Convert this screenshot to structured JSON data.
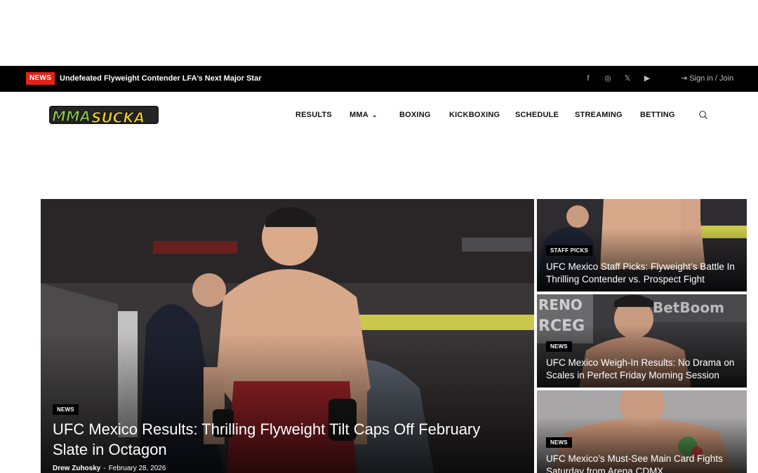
{
  "topbar": {
    "badge": "NEWS",
    "ticker": "Undefeated Flyweight Contender LFA’s Next Major Star",
    "social": [
      {
        "icon": "facebook-icon",
        "glyph": "f"
      },
      {
        "icon": "instagram-icon",
        "glyph": "◎"
      },
      {
        "icon": "x-twitter-icon",
        "glyph": "𝕏"
      },
      {
        "icon": "youtube-icon",
        "glyph": "▶"
      }
    ],
    "signin": "Sign in / Join"
  },
  "logo": {
    "text_left": "MMA",
    "text_right": "SUCKA"
  },
  "nav": {
    "items": [
      "RESULTS",
      "MMA",
      "BOXING",
      "KICKBOXING",
      "SCHEDULE",
      "STREAMING",
      "BETTING"
    ]
  },
  "featured": {
    "category": "NEWS",
    "title": "UFC Mexico Results: Thrilling Flyweight Tilt Caps Off February Slate in Octagon",
    "author": "Drew Zuhosky",
    "separator": "-",
    "date": "February 28, 2026"
  },
  "side_articles": [
    {
      "category": "STAFF PICKS",
      "title": "UFC Mexico Staff Picks: Flyweight’s Battle In Thrilling Contender vs. Prospect Fight"
    },
    {
      "category": "NEWS",
      "title": "UFC Mexico Weigh-In Results: No Drama on Scales in Perfect Friday Morning Session"
    },
    {
      "category": "NEWS",
      "title": "UFC Mexico’s Must-See Main Card Fights Saturday from Arena CDMX"
    }
  ],
  "colors": {
    "accent": "#e2231a",
    "topbar": "#000000",
    "logo_green": "#8bc34a",
    "logo_yellow": "#f2d21b"
  }
}
